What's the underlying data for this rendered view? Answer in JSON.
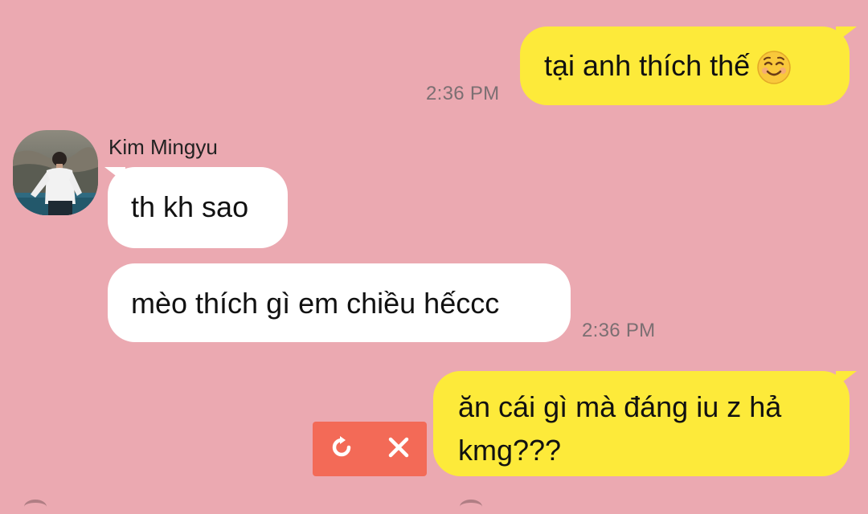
{
  "messages": [
    {
      "direction": "outgoing",
      "text": "tại anh thích thế",
      "emoji": "smiling-face-icon",
      "time": "2:36 PM"
    },
    {
      "direction": "incoming",
      "sender": "Kim Mingyu",
      "text": "th kh sao"
    },
    {
      "direction": "incoming",
      "text": "mèo thích gì em chiều hếccc",
      "time": "2:36 PM"
    },
    {
      "direction": "outgoing",
      "text_line1": "ăn cái gì mà đáng iu z hả",
      "text_line2": "kmg???",
      "status": "failed"
    }
  ],
  "colors": {
    "background": "#eba9b1",
    "outgoing_bubble": "#fdea3a",
    "incoming_bubble": "#ffffff",
    "failed_actions": "#f36a57"
  },
  "icons": {
    "retry": "retry-icon",
    "cancel": "close-icon"
  }
}
